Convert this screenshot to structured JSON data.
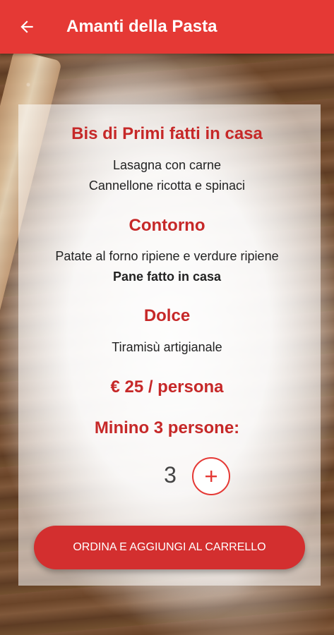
{
  "app_bar": {
    "title": "Amanti della Pasta",
    "back_icon": "arrow-left-icon",
    "color": "#e53935"
  },
  "menu": {
    "primi": {
      "title": "Bis di Primi fatti in casa",
      "items": [
        "Lasagna con carne",
        "Cannellone ricotta e spinaci"
      ]
    },
    "contorno": {
      "title": "Contorno",
      "items": [
        "Patate al forno ripiene e verdure ripiene"
      ],
      "bold_item": "Pane fatto in casa"
    },
    "dolce": {
      "title": "Dolce",
      "items": [
        "Tiramisù artigianale"
      ]
    },
    "price": "€ 25 / persona",
    "minimum": "Minino 3 persone:"
  },
  "quantity": {
    "value": "3",
    "increment_icon": "plus-icon"
  },
  "order_button": {
    "label": "ORDINA E AGGIUNGI AL CARRELLO"
  },
  "colors": {
    "accent": "#e53935",
    "title_red": "#c62828",
    "button_red": "#d32f2f"
  }
}
